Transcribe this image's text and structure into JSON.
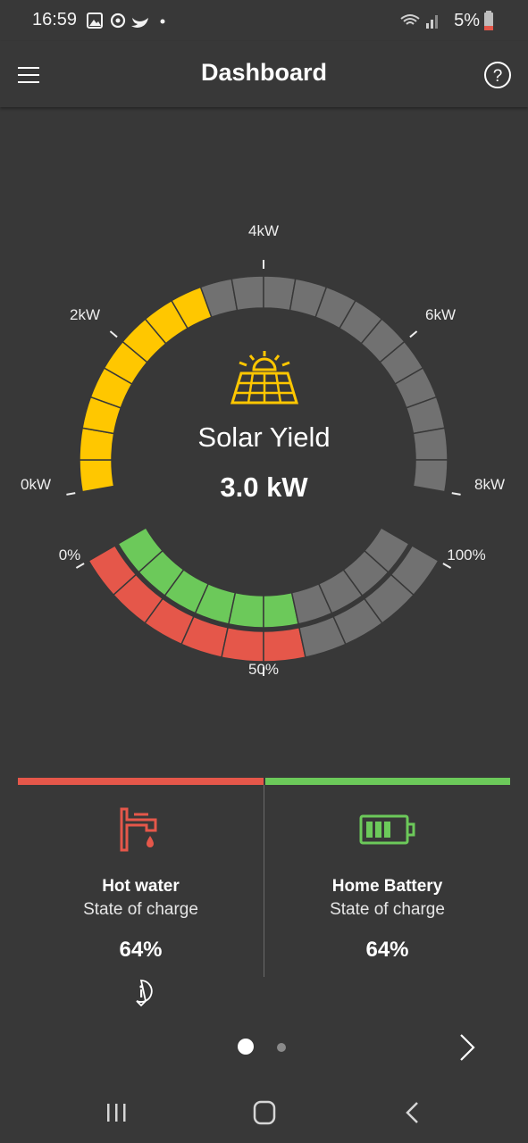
{
  "status_bar": {
    "time": "16:59",
    "battery_percent": "5%",
    "icons": [
      "gallery-icon",
      "sync-icon",
      "twitter-icon",
      "notification-dot-icon",
      "wifi-icon",
      "signal-icon",
      "battery-icon"
    ]
  },
  "app_bar": {
    "title": "Dashboard",
    "menu_icon": "hamburger-menu-icon",
    "help_icon": "help-icon"
  },
  "solar_gauge": {
    "title": "Solar Yield",
    "value": "3.0 kW",
    "icon": "solar-panel-icon",
    "scale_labels": {
      "min": "0kW",
      "q1": "2kW",
      "mid": "4kW",
      "q3": "6kW",
      "max": "8kW"
    },
    "level_fraction": 0.375
  },
  "charge_gauge": {
    "scale_labels": {
      "min": "0%",
      "mid": "50%",
      "max": "100%"
    },
    "hot_water_fraction": 0.64,
    "battery_fraction": 0.64
  },
  "colors": {
    "background": "#383838",
    "solar": "#ffc700",
    "inactive_segment": "#717171",
    "hot_water": "#e5574a",
    "battery": "#6cc95a"
  },
  "cards": {
    "hot_water": {
      "title": "Hot water",
      "subtitle": "State of charge",
      "value": "64%",
      "icon": "faucet-icon",
      "info_icon": "info-icon"
    },
    "home_battery": {
      "title": "Home Battery",
      "subtitle": "State of charge",
      "value": "64%",
      "icon": "battery-icon"
    }
  },
  "pagination": {
    "pages": 2,
    "current": 1,
    "next_icon": "chevron-right-icon"
  },
  "nav_bar": {
    "icons": [
      "recent-apps-icon",
      "home-icon",
      "back-icon"
    ]
  }
}
